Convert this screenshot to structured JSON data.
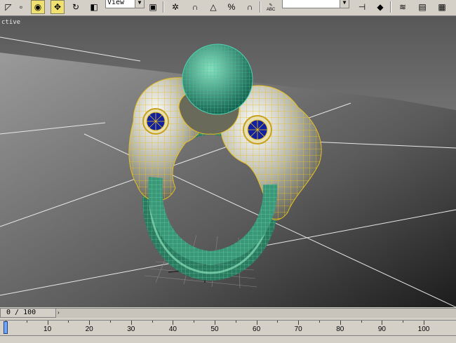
{
  "toolbar": {
    "view_dropdown": "View",
    "abc_label": "ABC",
    "icons": [
      "select-region-icon",
      "select-object-icon",
      "move-icon",
      "rotate-icon",
      "scale-icon",
      "pivot-icon",
      "link-icon",
      "snap-icon",
      "angle-snap-icon",
      "percent-snap-icon",
      "spinner-snap-icon",
      "text-icon",
      "named-selection-icon",
      "mirror-icon",
      "align-icon",
      "layer-icon",
      "curve-editor-icon",
      "schematic-icon"
    ]
  },
  "viewport": {
    "label": "ctive",
    "background": "#5e5e5e",
    "ring_wire_color": "#e8c020",
    "band_color": "#58c8a0",
    "gem_color": "#30b090",
    "inlay_color": "#1020a0"
  },
  "timebar": {
    "frame_display": "0 / 100",
    "current_frame": 0,
    "total_frames": 100
  },
  "ruler": {
    "labels": [
      "10",
      "20",
      "30",
      "40",
      "50",
      "60",
      "70",
      "80",
      "90",
      "100"
    ]
  }
}
